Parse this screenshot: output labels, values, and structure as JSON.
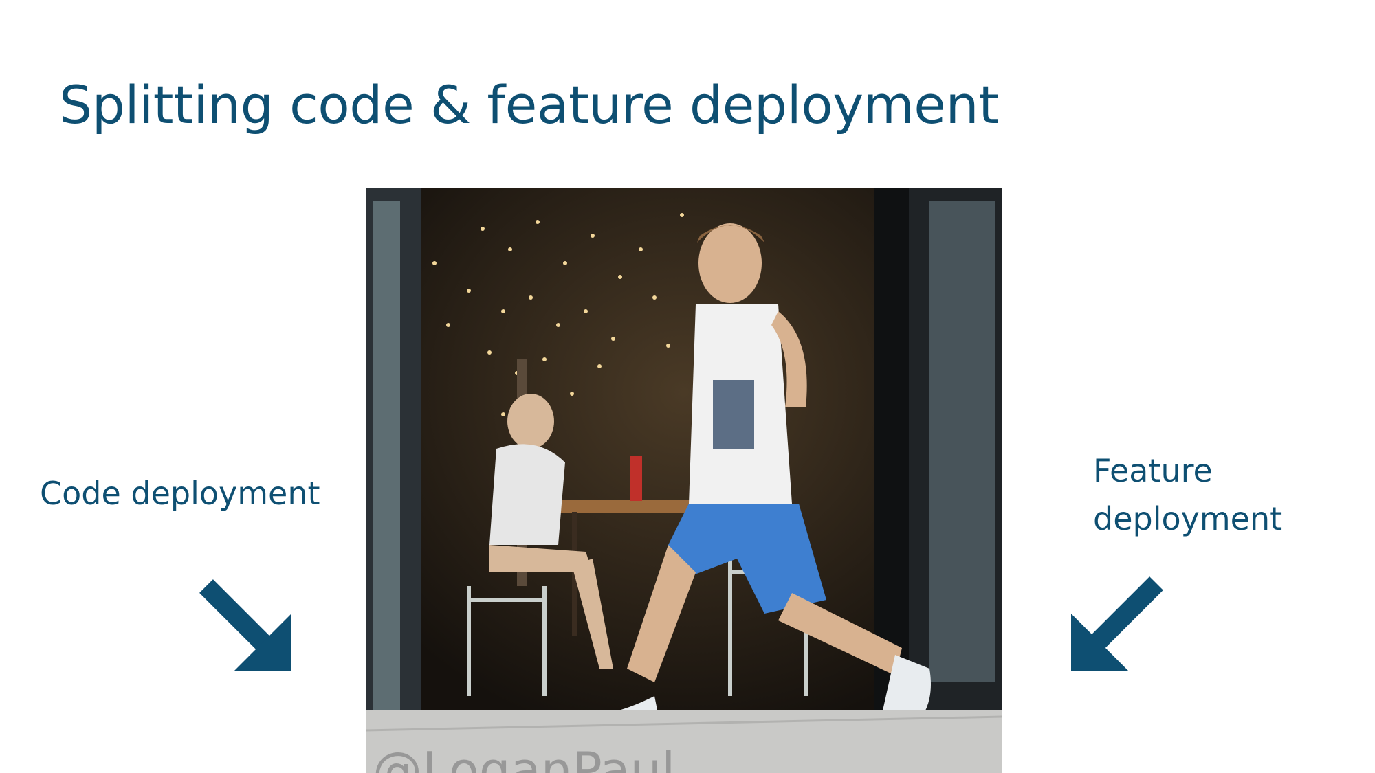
{
  "slide": {
    "title": "Splitting code & feature deployment",
    "accent_color": "#0e4f72"
  },
  "labels": {
    "left": "Code deployment",
    "right_line1": "Feature",
    "right_line2": "deployment"
  },
  "photo": {
    "watermark": "@LoganPaul",
    "icon": "photo-of-man-striding-out-of-cafe"
  }
}
